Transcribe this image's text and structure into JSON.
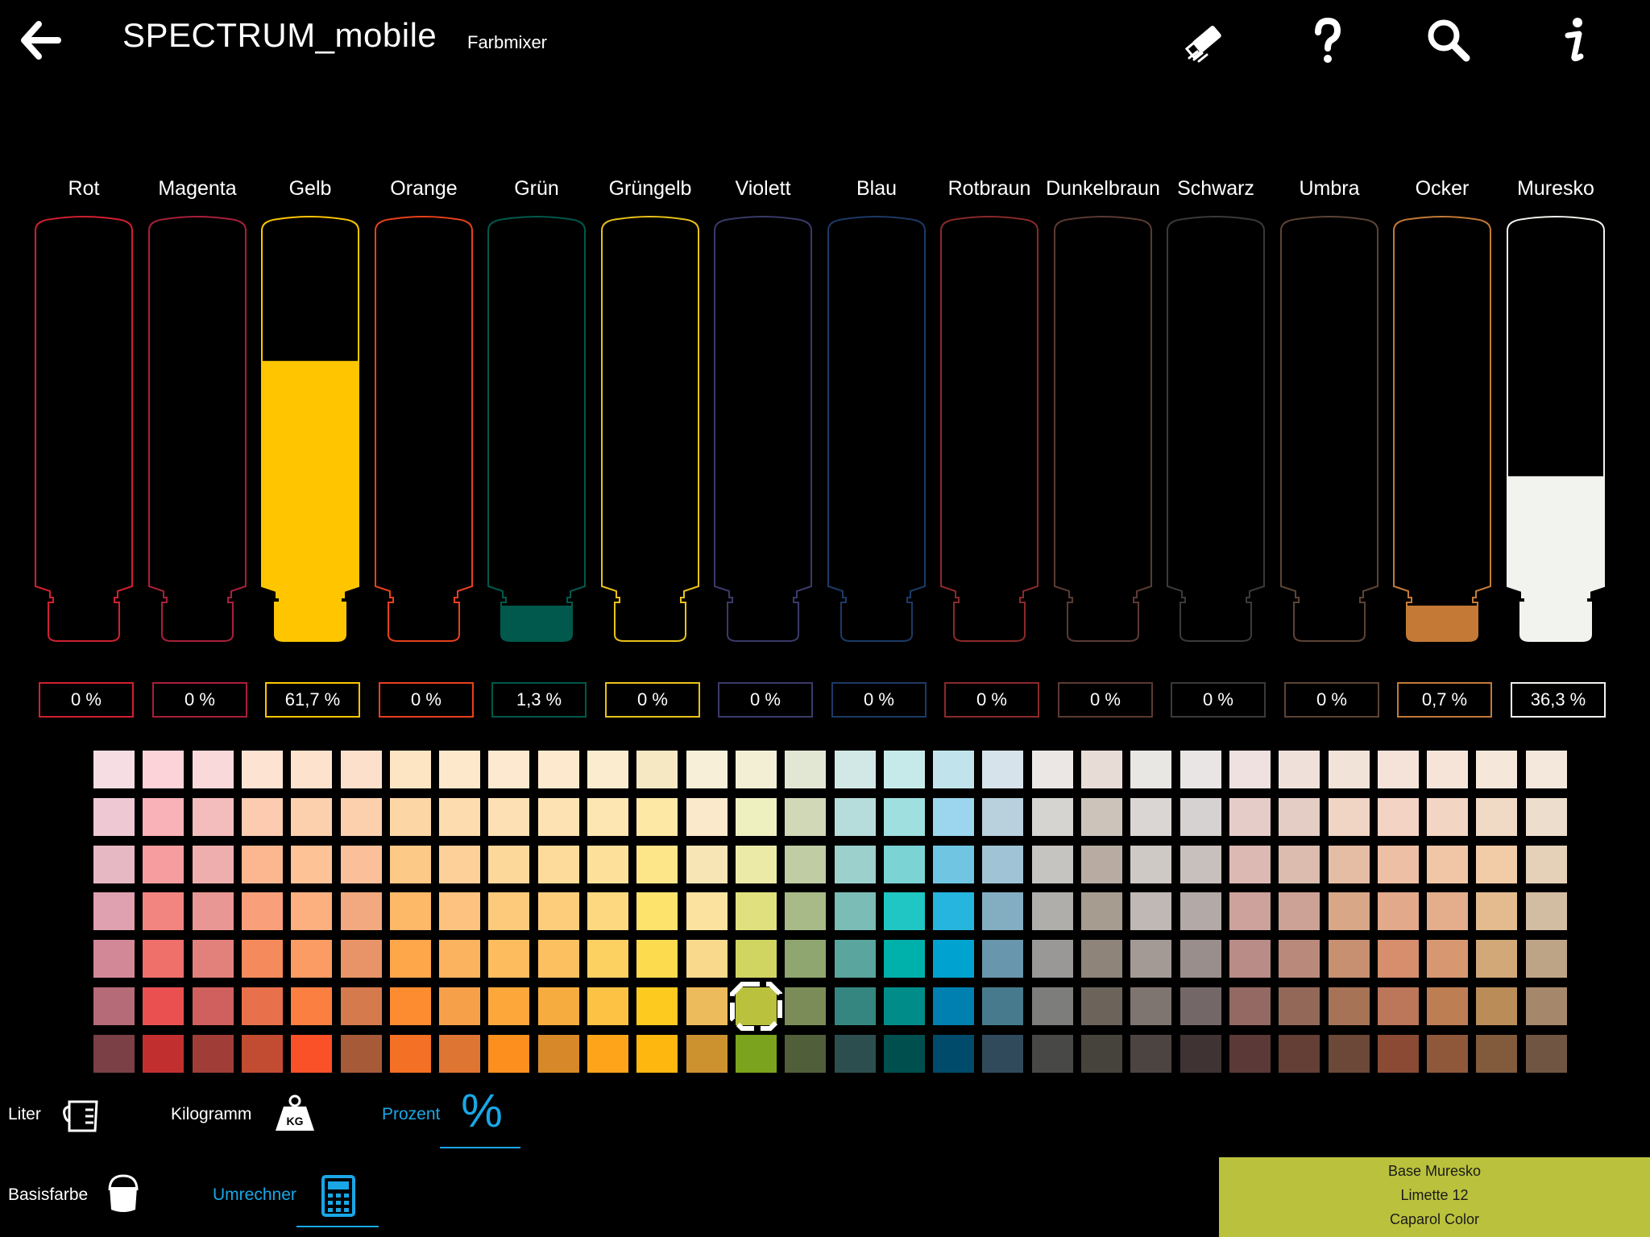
{
  "header": {
    "title": "SPECTRUM_mobile",
    "subtitle": "Farbmixer",
    "icons": [
      "back-arrow-icon",
      "eraser-icon",
      "help-icon",
      "search-icon",
      "info-icon"
    ]
  },
  "tubes": [
    {
      "label": "Rot",
      "value": "0 %",
      "fill": 0,
      "color": "#d12030"
    },
    {
      "label": "Magenta",
      "value": "0 %",
      "fill": 0,
      "color": "#a8203a"
    },
    {
      "label": "Gelb",
      "value": "61,7 %",
      "fill": 0.617,
      "color": "#ffc600"
    },
    {
      "label": "Orange",
      "value": "0 %",
      "fill": 0,
      "color": "#e8401c"
    },
    {
      "label": "Grün",
      "value": "1,3 %",
      "fill": 0.013,
      "color": "#00594c"
    },
    {
      "label": "Grüngelb",
      "value": "0 %",
      "fill": 0,
      "color": "#e9c21a"
    },
    {
      "label": "Violett",
      "value": "0 %",
      "fill": 0,
      "color": "#3a3a6a"
    },
    {
      "label": "Blau",
      "value": "0 %",
      "fill": 0,
      "color": "#1c3a66"
    },
    {
      "label": "Rotbraun",
      "value": "0 %",
      "fill": 0,
      "color": "#8a2a2a"
    },
    {
      "label": "Dunkelbraun",
      "value": "0 %",
      "fill": 0,
      "color": "#5a3a32"
    },
    {
      "label": "Schwarz",
      "value": "0 %",
      "fill": 0,
      "color": "#3a3a3a"
    },
    {
      "label": "Umbra",
      "value": "0 %",
      "fill": 0,
      "color": "#5c4436"
    },
    {
      "label": "Ocker",
      "value": "0,7 %",
      "fill": 0.007,
      "color": "#c47a36"
    },
    {
      "label": "Muresko",
      "value": "36,3 %",
      "fill": 0.363,
      "color": "#f2f2ee"
    }
  ],
  "swatches": {
    "rows": 7,
    "columns": [
      [
        "#f5dde3",
        "#eec9d4",
        "#e6b8c4",
        "#dfa0b0",
        "#d38898",
        "#b56b78",
        "#7a4046"
      ],
      [
        "#fbd3d8",
        "#f9b2b8",
        "#f69e9f",
        "#f2857f",
        "#ef6f6b",
        "#ea5050",
        "#c1302f"
      ],
      [
        "#f9d9da",
        "#f4bdbd",
        "#efaeae",
        "#e99794",
        "#e2807c",
        "#cf605d",
        "#a13d37"
      ],
      [
        "#fde3d2",
        "#fdcbb0",
        "#fcb791",
        "#f9a07a",
        "#f58a5c",
        "#e8704b",
        "#c24c31"
      ],
      [
        "#fde2cd",
        "#fdd0ad",
        "#fdc397",
        "#fcb07f",
        "#fb9c64",
        "#fb7f41",
        "#fb5129"
      ],
      [
        "#fde0cb",
        "#fcd0ac",
        "#fbc09a",
        "#f3a97f",
        "#e89468",
        "#d47a4d",
        "#a75a38"
      ],
      [
        "#fde5c4",
        "#fdd6a6",
        "#fdc986",
        "#fdb868",
        "#fda64a",
        "#fd8c30",
        "#f47024"
      ],
      [
        "#fde8cb",
        "#fddcb0",
        "#fdd099",
        "#fdc27f",
        "#fcb35f",
        "#f7a04a",
        "#df7533"
      ],
      [
        "#fde9cf",
        "#fde1b4",
        "#fdd89b",
        "#fdca7b",
        "#fdbd5f",
        "#fda73a",
        "#fd8f1e"
      ],
      [
        "#fde9cd",
        "#fde3b4",
        "#fddb9b",
        "#fdcd7c",
        "#fdc060",
        "#f7ac40",
        "#d78828"
      ],
      [
        "#fbeccf",
        "#fde6b1",
        "#fde19a",
        "#fdd880",
        "#fdd062",
        "#fdc244",
        "#fda41a"
      ],
      [
        "#f7e8c4",
        "#fde8a6",
        "#fde58a",
        "#fde36c",
        "#fddb4e",
        "#fdca1f",
        "#fdb70f"
      ],
      [
        "#f7efd7",
        "#faeacb",
        "#f8e5b6",
        "#fbe29f",
        "#f9d98c",
        "#ecbb5b",
        "#cc9230"
      ],
      [
        "#f3efd5",
        "#eef0c0",
        "#ebeba7",
        "#e0e17e",
        "#cfd560",
        "#bac13c",
        "#7ca31d"
      ],
      [
        "#e2e7d4",
        "#d0d8b8",
        "#bfcca4",
        "#a7ba88",
        "#8fa670",
        "#7b8c59",
        "#505e3a"
      ],
      [
        "#d2e8e6",
        "#b6dddb",
        "#9bd0cd",
        "#7bbcb6",
        "#5aa59e",
        "#358680",
        "#2d4e4e"
      ],
      [
        "#c6eaea",
        "#9fdfdf",
        "#7bd3d4",
        "#20c6c4",
        "#00b0ab",
        "#008d89",
        "#004f4f"
      ],
      [
        "#c1e4ec",
        "#9bd6ee",
        "#70c5e3",
        "#25b5de",
        "#00a3cf",
        "#0080b1",
        "#004b6b"
      ],
      [
        "#d6e3ea",
        "#b8d1dd",
        "#a0c4d5",
        "#83aec2",
        "#6896ac",
        "#477a8c",
        "#304a5c"
      ],
      [
        "#ebe7e4",
        "#d6d4d0",
        "#c6c4c0",
        "#b0aeab",
        "#9a9896",
        "#7d7e7b",
        "#484846"
      ],
      [
        "#e8ddd6",
        "#ccc4ba",
        "#b8aca2",
        "#a79c90",
        "#8e8479",
        "#6c645b",
        "#45433c"
      ],
      [
        "#e9e7e4",
        "#d9d6d3",
        "#cfc9c6",
        "#bfb8b4",
        "#a39a96",
        "#7e7470",
        "#4c4440"
      ],
      [
        "#e8e5e4",
        "#d6d2d1",
        "#c8c0bd",
        "#b3a9a6",
        "#9a8e8d",
        "#736767",
        "#3f3433"
      ],
      [
        "#eee1df",
        "#e6ccc9",
        "#dcb9b3",
        "#cda19c",
        "#b98c87",
        "#946863",
        "#5a3937"
      ],
      [
        "#efe1da",
        "#e4cdc4",
        "#dbbcaf",
        "#cba295",
        "#b98a7b",
        "#946859",
        "#633f36"
      ],
      [
        "#f2e3d9",
        "#f0d4c4",
        "#e5bda5",
        "#d8a787",
        "#c69071",
        "#a67357",
        "#6c4838"
      ],
      [
        "#f5e3da",
        "#f3d3c4",
        "#edbfa5",
        "#e2a98b",
        "#d68e6d",
        "#bc7659",
        "#8b4a34"
      ],
      [
        "#f6e4d9",
        "#f3d5c3",
        "#f0c6a7",
        "#e4ad8b",
        "#d79771",
        "#be7e54",
        "#8f583a"
      ],
      [
        "#f5e8da",
        "#f0dac5",
        "#f1cca7",
        "#e3bb8f",
        "#d2a878",
        "#b98c58",
        "#815b3b"
      ],
      [
        "#f4e8dd",
        "#ecddcc",
        "#e4d1b8",
        "#d2bda3",
        "#bea486",
        "#a5876b",
        "#6f5542"
      ]
    ],
    "selected": {
      "column": 13,
      "row": 5,
      "color": "#bac13c"
    }
  },
  "units": {
    "liter_label": "Liter",
    "kilogramm_label": "Kilogramm",
    "prozent_label": "Prozent",
    "prozent_symbol": "%",
    "kg_badge": "KG",
    "active": "Prozent"
  },
  "tools": {
    "basisfarbe_label": "Basisfarbe",
    "umrechner_label": "Umrechner",
    "active": "Umrechner"
  },
  "result": {
    "line1": "Base Muresko",
    "line2": "Limette 12",
    "line3": "Caparol Color",
    "color": "#bac13c"
  }
}
